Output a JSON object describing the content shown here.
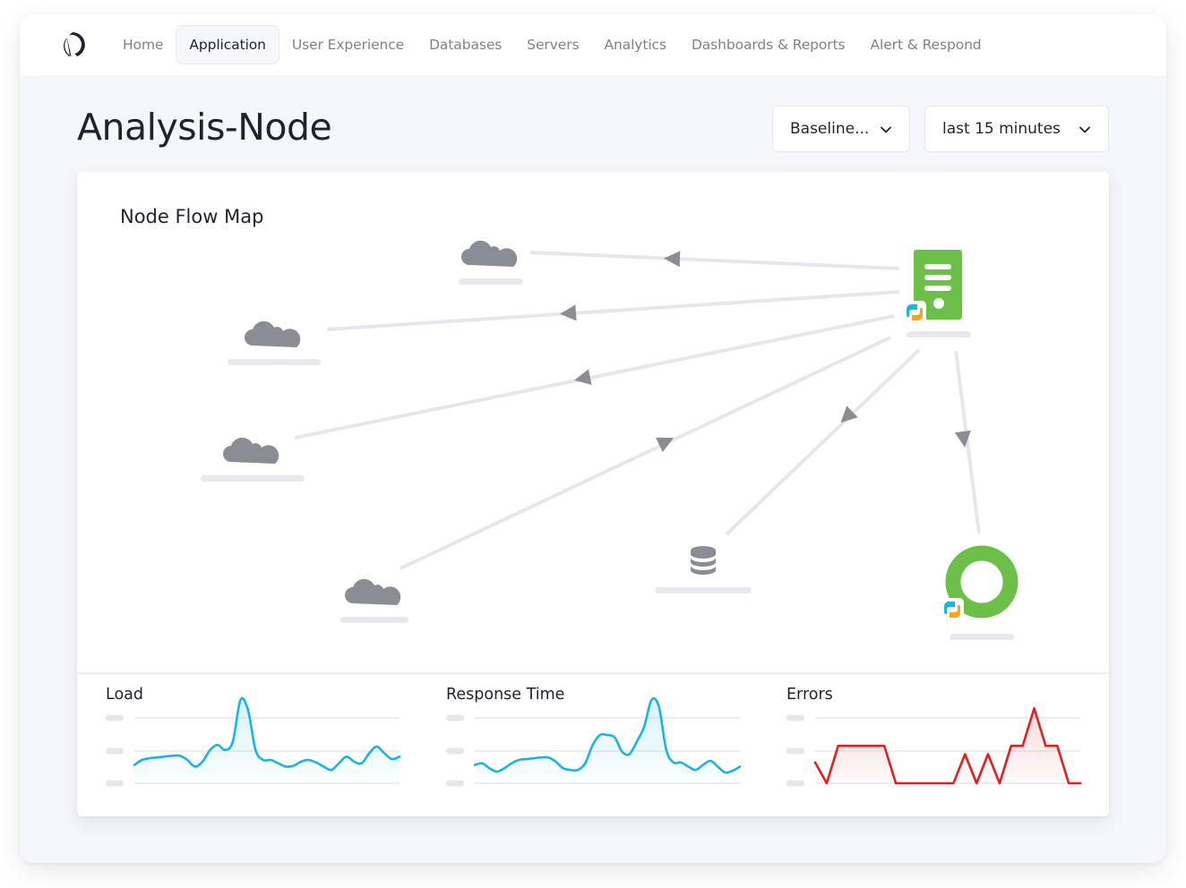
{
  "nav": {
    "logo": "app-logo",
    "items": [
      {
        "label": "Home",
        "active": false
      },
      {
        "label": "Application",
        "active": true
      },
      {
        "label": "User Experience",
        "active": false
      },
      {
        "label": "Databases",
        "active": false
      },
      {
        "label": "Servers",
        "active": false
      },
      {
        "label": "Analytics",
        "active": false
      },
      {
        "label": "Dashboards & Reports",
        "active": false
      },
      {
        "label": "Alert & Respond",
        "active": false
      }
    ]
  },
  "header": {
    "title": "Analysis-Node",
    "baseline_dropdown": {
      "value": "Baseline...",
      "icon": "chevron-down-icon"
    },
    "time_dropdown": {
      "value": "last 15 minutes",
      "icon": "chevron-down-icon"
    }
  },
  "flow_map": {
    "title": "Node Flow Map",
    "colors": {
      "node_green": "#6cc04a",
      "icon_gray": "#8a8d93",
      "edge": "#e6e7ed",
      "python_blue": "#1fb3e6",
      "python_orange": "#f6a61e"
    },
    "nodes": [
      {
        "id": "app-server",
        "type": "server",
        "icon": "server-icon",
        "badge": "python-icon",
        "label": ""
      },
      {
        "id": "cloud-1",
        "type": "cloud",
        "icon": "cloud-icon",
        "label": ""
      },
      {
        "id": "cloud-2",
        "type": "cloud",
        "icon": "cloud-icon",
        "label": ""
      },
      {
        "id": "cloud-3",
        "type": "cloud",
        "icon": "cloud-icon",
        "label": ""
      },
      {
        "id": "cloud-4",
        "type": "cloud",
        "icon": "cloud-icon",
        "label": ""
      },
      {
        "id": "database",
        "type": "database",
        "icon": "database-icon",
        "label": ""
      },
      {
        "id": "python-service",
        "type": "service",
        "icon": "ring-icon",
        "badge": "python-icon",
        "label": ""
      }
    ],
    "edges": [
      {
        "from": "app-server",
        "to": "cloud-1"
      },
      {
        "from": "app-server",
        "to": "cloud-2"
      },
      {
        "from": "app-server",
        "to": "cloud-3"
      },
      {
        "from": "cloud-4",
        "to": "app-server"
      },
      {
        "from": "database",
        "to": "app-server"
      },
      {
        "from": "app-server",
        "to": "python-service"
      }
    ]
  },
  "metrics": [
    {
      "title": "Load",
      "color": "#1ab4e0",
      "values": [
        0.22,
        0.28,
        0.3,
        0.31,
        0.32,
        0.33,
        0.33,
        0.28,
        0.2,
        0.26,
        0.4,
        0.46,
        0.4,
        0.5,
        1.0,
        0.88,
        0.4,
        0.28,
        0.28,
        0.24,
        0.2,
        0.21,
        0.26,
        0.28,
        0.25,
        0.2,
        0.16,
        0.24,
        0.32,
        0.26,
        0.24,
        0.36,
        0.44,
        0.36,
        0.29,
        0.32
      ]
    },
    {
      "title": "Response Time",
      "color": "#1ab4e0",
      "values": [
        0.22,
        0.24,
        0.18,
        0.14,
        0.18,
        0.24,
        0.28,
        0.29,
        0.3,
        0.31,
        0.31,
        0.26,
        0.18,
        0.16,
        0.16,
        0.24,
        0.46,
        0.58,
        0.58,
        0.55,
        0.38,
        0.35,
        0.5,
        0.68,
        1.0,
        0.92,
        0.4,
        0.25,
        0.25,
        0.2,
        0.16,
        0.22,
        0.27,
        0.2,
        0.13,
        0.15,
        0.2
      ]
    },
    {
      "title": "Errors",
      "color": "#e02020",
      "values": [
        0.25,
        0.0,
        0.45,
        0.45,
        0.45,
        0.45,
        0.45,
        0.0,
        0.0,
        0.0,
        0.0,
        0.0,
        0.0,
        0.35,
        0.0,
        0.35,
        0.0,
        0.45,
        0.45,
        0.9,
        0.45,
        0.45,
        0.0,
        0.0
      ]
    }
  ]
}
